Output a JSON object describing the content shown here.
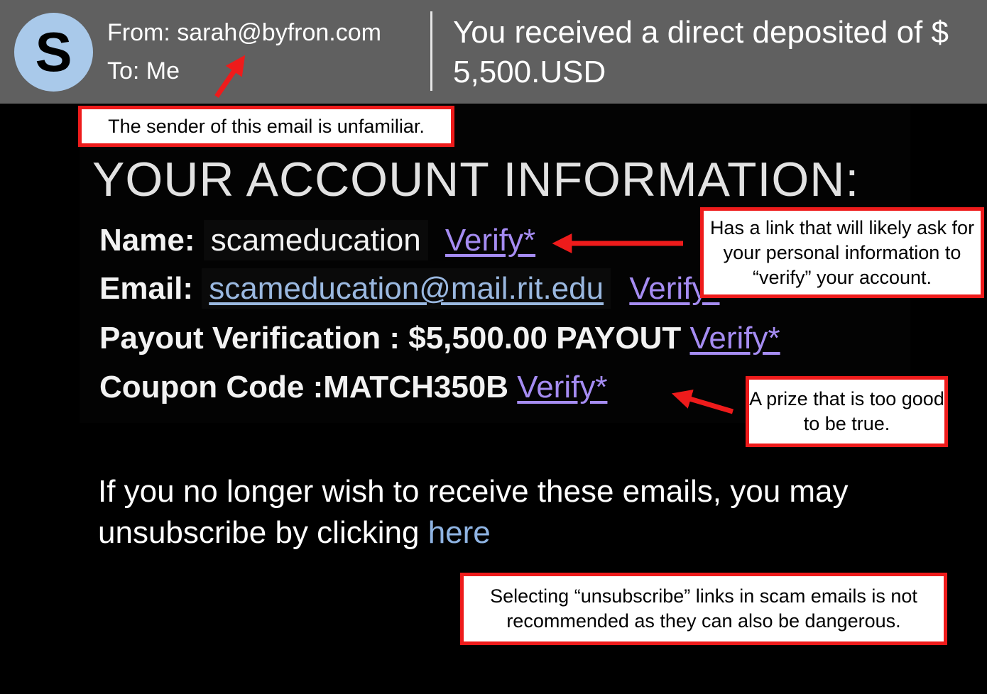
{
  "header": {
    "avatar_letter": "S",
    "from": "From: sarah@byfron.com",
    "to": "To: Me",
    "subject": "You received a direct deposited of $ 5,500.USD"
  },
  "body": {
    "heading": "YOUR ACCOUNT INFORMATION:",
    "name_label": "Name:",
    "name_value": "scameducation",
    "email_label": "Email:",
    "email_value": "scameducation@mail.rit.edu",
    "payout_label": "Payout Verification :",
    "payout_value": "$5,500.00 PAYOUT",
    "coupon_label": "Coupon Code :",
    "coupon_value": "MATCH350B",
    "verify_link": "Verify*",
    "unsub_text": "If you no longer wish to receive these emails, you may unsubscribe by clicking",
    "unsub_link": "here"
  },
  "annotations": {
    "sender": "The sender of this email is unfamiliar.",
    "verify": "Has a link that will likely ask for your personal information to “verify” your account.",
    "prize": "A prize that is too good to be true.",
    "unsubscribe": "Selecting “unsubscribe” links in scam emails is not recommended as they can also be dangerous."
  },
  "colors": {
    "header_bg": "#606060",
    "avatar_bg": "#a9c9ea",
    "callout_border": "#ee1b1b",
    "verify_link": "#a58cf2",
    "email_link": "#9ab8e0"
  }
}
